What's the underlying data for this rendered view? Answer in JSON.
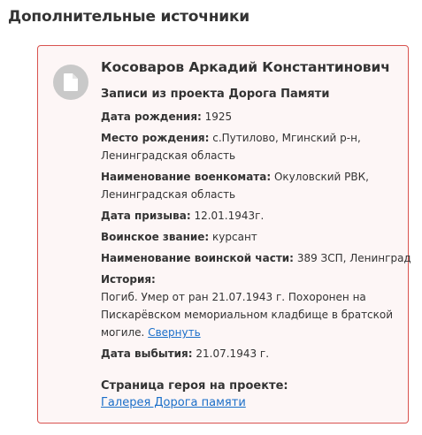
{
  "section": {
    "title": "Дополнительные источники"
  },
  "card": {
    "icon": "document-icon",
    "person_name": "Косоваров Аркадий Константинович",
    "records_title": "Записи из проекта Дорога Памяти",
    "fields": {
      "birth_date": {
        "label": "Дата рождения:",
        "value": "1925"
      },
      "birth_place": {
        "label": "Место рождения:",
        "value": "с.Путилово, Мгинский р-н,",
        "value2": "Ленинградская область"
      },
      "commissariat": {
        "label": "Наименование военкомата:",
        "value": "Окуловский РВК,",
        "value2": "Ленинградская область"
      },
      "draft_date": {
        "label": "Дата призыва:",
        "value": "12.01.1943г."
      },
      "rank": {
        "label": "Воинское звание:",
        "value": "курсант"
      },
      "unit": {
        "label": "Наименование воинской части:",
        "value": "389 ЗСП, Ленинград"
      },
      "history": {
        "label": "История:",
        "line1": "Погиб. Умер от ран 21.07.1943 г. Похоронен на",
        "line2": "Пискарёвском мемориальном кладбище в братской",
        "line3": "могиле.",
        "collapse_link": "Свернуть"
      },
      "departure_date": {
        "label": "Дата выбытия:",
        "value": "21.07.1943 г."
      }
    },
    "hero_page": {
      "title": "Страница героя на проекте:",
      "link": "Галерея Дорога памяти"
    }
  },
  "colors": {
    "card_border": "#d9534f",
    "card_background": "#fdf6f6",
    "icon_circle": "#c9c9c9",
    "link": "#1a6fc9"
  }
}
